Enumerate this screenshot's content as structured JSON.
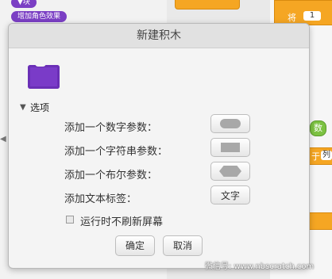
{
  "background": {
    "palette_blocks": [
      "▼块",
      "增加角色效果"
    ],
    "script_block_text": "将",
    "script_block_input": "1",
    "green_block_text": "数",
    "orange_text_1": "于",
    "orange_text_2": "列"
  },
  "dialog": {
    "title": "新建积木",
    "options_label": "选项",
    "rows": [
      {
        "label": "添加一个数字参数：",
        "shape": "oval"
      },
      {
        "label": "添加一个字符串参数：",
        "shape": "rect"
      },
      {
        "label": "添加一个布尔参数：",
        "shape": "hex"
      },
      {
        "label": "添加文本标签：",
        "button_text": "文字"
      }
    ],
    "checkbox_label": "运行时不刷新屏幕",
    "ok_label": "确定",
    "cancel_label": "取消"
  },
  "watermark": "微信号: www.nbscratch.com",
  "colors": {
    "block_purple": "#7a3bc8",
    "block_orange": "#f5a623",
    "block_green": "#7cc242"
  }
}
